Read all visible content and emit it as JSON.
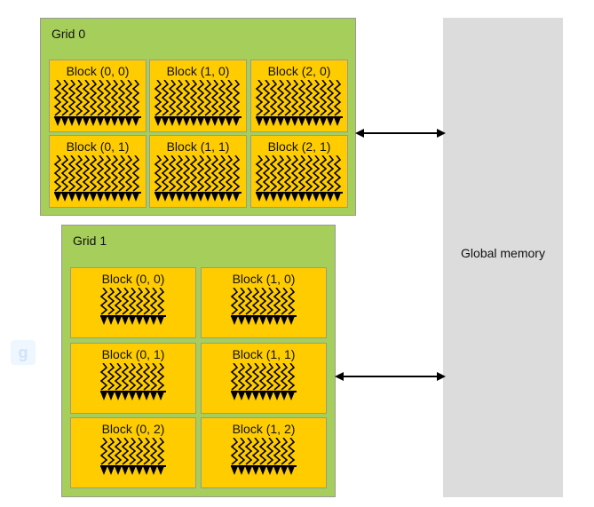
{
  "grids": [
    {
      "title": "Grid 0",
      "threads_per_block": 12,
      "blocks": [
        "Block (0, 0)",
        "Block (1, 0)",
        "Block (2, 0)",
        "Block (0, 1)",
        "Block (1, 1)",
        "Block (2, 1)"
      ]
    },
    {
      "title": "Grid 1",
      "threads_per_block": 9,
      "blocks": [
        "Block (0, 0)",
        "Block (1, 0)",
        "Block (0, 1)",
        "Block (1, 1)",
        "Block (0, 2)",
        "Block (1, 2)"
      ]
    }
  ],
  "global_memory": {
    "label": "Global memory"
  },
  "colors": {
    "grid": "#a6ce5a",
    "block": "#ffcc00",
    "memory": "#dcdcdc"
  }
}
